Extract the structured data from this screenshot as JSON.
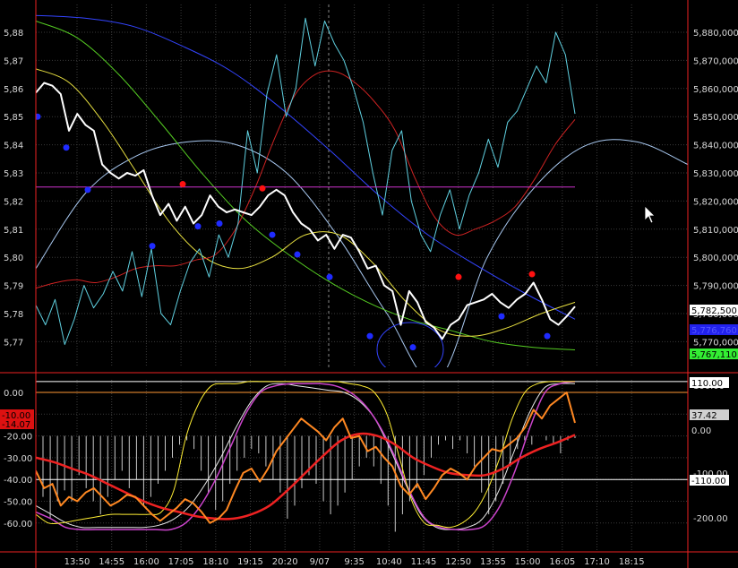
{
  "chart_data": [
    {
      "type": "line",
      "panel": "price",
      "left_ticks": [
        "5,88",
        "5,87",
        "5,86",
        "5,85",
        "5,84",
        "5,83",
        "5,82",
        "5,81",
        "5,80",
        "5,79",
        "5,78",
        "5,77"
      ],
      "right_ticks": [
        "5,880,000",
        "5,870,000",
        "5,860,000",
        "5,850,000",
        "5,840,000",
        "5,830,000",
        "5,820,000",
        "5,810,000",
        "5,800,000",
        "5,790,000",
        "5,780,000",
        "5,770,000"
      ],
      "ylim_right": [
        5765000,
        5889000
      ],
      "price_series": {
        "color": "#ffffff",
        "values": [
          5858500,
          5862000,
          5861000,
          5858000,
          5845000,
          5851000,
          5847000,
          5845000,
          5833000,
          5830000,
          5828000,
          5830000,
          5829000,
          5831000,
          5822000,
          5815000,
          5819000,
          5813000,
          5818000,
          5812000,
          5815000,
          5822000,
          5818000,
          5816000,
          5817000,
          5816000,
          5815000,
          5818000,
          5822000,
          5824000,
          5822000,
          5816000,
          5812000,
          5810000,
          5806000,
          5808000,
          5803000,
          5808000,
          5807000,
          5802000,
          5796000,
          5797000,
          5790000,
          5788000,
          5776000,
          5788000,
          5784000,
          5777000,
          5775000,
          5771000,
          5776000,
          5778000,
          5783000,
          5784000,
          5785000,
          5787000,
          5784000,
          5782000,
          5785000,
          5787000,
          5791000,
          5785000,
          5778000,
          5776000,
          5779000,
          5782500
        ]
      },
      "cyan_series": {
        "color": "#5fd0e0",
        "values": [
          5783000,
          5776000,
          5785000,
          5769000,
          5778000,
          5790000,
          5782000,
          5787000,
          5795000,
          5788000,
          5802000,
          5786000,
          5803000,
          5780000,
          5776000,
          5788000,
          5798000,
          5803000,
          5793000,
          5808000,
          5800000,
          5812000,
          5845000,
          5830000,
          5858000,
          5872000,
          5850000,
          5860000,
          5885000,
          5868000,
          5884000,
          5876000,
          5870000,
          5860000,
          5848000,
          5830000,
          5815000,
          5838000,
          5845000,
          5820000,
          5808000,
          5802000,
          5815000,
          5824000,
          5810000,
          5822000,
          5830000,
          5842000,
          5832000,
          5848000,
          5852000,
          5860000,
          5868000,
          5862000,
          5880000,
          5872000,
          5851000
        ]
      },
      "red_series": {
        "color": "#cc2222",
        "values": [
          5789000,
          5791000,
          5792000,
          5791000,
          5793000,
          5796000,
          5797000,
          5797000,
          5799000,
          5801000,
          5810000,
          5825000,
          5843000,
          5858000,
          5865000,
          5866000,
          5862000,
          5855000,
          5845000,
          5828000,
          5814000,
          5808000,
          5810000,
          5813000,
          5818000,
          5828000,
          5840000,
          5849000
        ]
      },
      "blue_curve": {
        "color": "#3344ff",
        "values": [
          5886000,
          5885000,
          5882000,
          5875000,
          5866000,
          5853000,
          5838000,
          5822000,
          5808000,
          5797000,
          5787000,
          5778000
        ]
      },
      "green_curve": {
        "color": "#55cc22",
        "values": [
          5884000,
          5878000,
          5865000,
          5848000,
          5830000,
          5814000,
          5802000,
          5792000,
          5784000,
          5778000,
          5774000,
          5770000,
          5768000,
          5767110
        ]
      },
      "yellow_curve": {
        "color": "#e8e040",
        "values": [
          5867000,
          5862000,
          5848000,
          5830000,
          5812000,
          5800000,
          5796000,
          5800000,
          5808000,
          5808000,
          5798000,
          5784000,
          5774000,
          5772000,
          5775000,
          5780000,
          5784000
        ]
      },
      "lightblue_curve": {
        "color": "#a8c8f0",
        "values": [
          5796000,
          5823000,
          5836000,
          5841000,
          5840000,
          5830000,
          5808000,
          5780000,
          5756000,
          5800000,
          5826000,
          5840000,
          5841000,
          5833000
        ]
      },
      "horizontal_line": {
        "value": 5825000,
        "color": "#cc33cc"
      },
      "red_dots": [
        5826000,
        5824500,
        5793000,
        5794000
      ],
      "blue_dots": [
        5850000,
        5839000,
        5824000,
        5804000,
        5811000,
        5812000,
        5808000,
        5801000,
        5793000,
        5772000,
        5768000,
        5779000,
        5772000
      ],
      "price_tags": [
        {
          "label": "5,782,500",
          "bg": "#ffffff",
          "fg": "#000000"
        },
        {
          "label": "5,776,760",
          "bg": "#2222ee",
          "fg": "#5555ff"
        },
        {
          "label": "5,767,110",
          "bg": "#33ee33",
          "fg": "#000000"
        }
      ]
    },
    {
      "type": "line",
      "panel": "oscillator",
      "left_ticks": [
        "0.00",
        "-10.00",
        "-20.00",
        "-30.00",
        "-40.00",
        "-50.00",
        "-60.00"
      ],
      "right_ticks": [
        "100.00",
        "0.00",
        "-100.00",
        "-200.00"
      ],
      "ylim_left": [
        -66,
        6
      ],
      "left_tags": [
        {
          "label": "-10.00",
          "bg": "#dd1111",
          "fg": "#000000"
        },
        {
          "label": "-14.07",
          "bg": "#dd1111",
          "fg": "#000000"
        }
      ],
      "right_tags": [
        {
          "label": "110.00",
          "bg": "#ffffff",
          "fg": "#000000"
        },
        {
          "label": "37.42",
          "bg": "#d0d0d0",
          "fg": "#000000"
        },
        {
          "label": "0.00",
          "bg": "#000000",
          "fg": "#d8d8d8"
        },
        {
          "label": "-110.00",
          "bg": "#ffffff",
          "fg": "#000000"
        }
      ],
      "histogram": {
        "color": "#c8c8c8",
        "baseline": -20,
        "values": [
          -42,
          -48,
          -58,
          -50,
          -45,
          -50,
          -38,
          -44,
          -50,
          -56,
          -48,
          -40,
          -36,
          -44,
          -40,
          -52,
          -48,
          -42,
          -36,
          -30,
          -24,
          -22,
          -26,
          -36,
          -46,
          -54,
          -50,
          -42,
          -36,
          -30,
          -26,
          -28,
          -34,
          -40,
          -46,
          -58,
          -52,
          -44,
          -38,
          -42,
          -50,
          -56,
          -52,
          -46,
          -40,
          -34,
          -30,
          -34,
          -42,
          -52,
          -64,
          -56,
          -50,
          -44,
          -38,
          -30,
          -24,
          -22,
          -26,
          -22,
          -28,
          -34,
          -46,
          -56,
          -50,
          -42,
          -34,
          -26,
          -22,
          -24,
          -20,
          -22,
          -24,
          -28,
          -22,
          -21
        ]
      },
      "orange_series": {
        "color": "#ff8822",
        "values": [
          -36,
          -44,
          -42,
          -52,
          -48,
          -50,
          -46,
          -44,
          -48,
          -52,
          -50,
          -47,
          -48,
          -52,
          -56,
          -59,
          -56,
          -53,
          -49,
          -51,
          -55,
          -60,
          -58,
          -54,
          -45,
          -37,
          -35,
          -41,
          -35,
          -27,
          -22,
          -17,
          -12,
          -15,
          -18,
          -22,
          -16,
          -12,
          -21,
          -20,
          -27,
          -25,
          -30,
          -34,
          -43,
          -47,
          -42,
          -49,
          -44,
          -38,
          -35,
          -37,
          -40,
          -34,
          -30,
          -26,
          -27,
          -24,
          -21,
          -16,
          -8,
          -12,
          -6,
          -3,
          0,
          -14
        ]
      },
      "red_series": {
        "color": "#ee2222",
        "values": [
          -30,
          -32,
          -35,
          -38,
          -42,
          -46,
          -50,
          -53,
          -55,
          -57,
          -58,
          -58,
          -56,
          -52,
          -45,
          -37,
          -29,
          -22,
          -19,
          -20,
          -24,
          -30,
          -34,
          -37,
          -38,
          -38,
          -35,
          -30,
          -26,
          -23,
          -19.5
        ]
      },
      "yellow_series": {
        "color": "#ffee33",
        "values": [
          -56,
          -60,
          -60,
          -59,
          -58,
          -57,
          -56,
          -56,
          -56,
          -56,
          -55,
          -45,
          -20,
          -5,
          3,
          4,
          4,
          5,
          5,
          5,
          5,
          5,
          5,
          5,
          5,
          4,
          3,
          0,
          -10,
          -30,
          -50,
          -60,
          -61,
          -62,
          -60,
          -55,
          -45,
          -30,
          -12,
          0,
          4,
          5,
          5,
          5
        ]
      },
      "magenta_series": {
        "color": "#cc44cc",
        "values": [
          -55,
          -58,
          -62,
          -63,
          -63,
          -63,
          -63,
          -63,
          -63,
          -63,
          -60,
          -52,
          -40,
          -25,
          -10,
          0,
          3,
          4,
          4,
          4,
          3,
          0,
          -6,
          -16,
          -30,
          -46,
          -58,
          -62,
          -63,
          -63,
          -61,
          -52,
          -36,
          -16,
          0,
          4,
          5
        ]
      },
      "white_curve": {
        "color": "#e8e8e8",
        "values": [
          -52,
          -56,
          -60,
          -62,
          -62,
          -62,
          -62,
          -62,
          -61,
          -58,
          -52,
          -42,
          -30,
          -16,
          -4,
          3,
          4,
          3,
          2,
          1,
          0,
          -4,
          -12,
          -26,
          -42,
          -56,
          -62,
          -63,
          -62,
          -58,
          -46,
          -28,
          -10,
          2,
          4,
          4
        ]
      },
      "hlines": [
        {
          "value": 5,
          "color": "#ffffff"
        },
        {
          "value": 0,
          "color": "#ff9933"
        },
        {
          "value": -40,
          "color": "#ffffff"
        }
      ]
    }
  ],
  "x_axis": {
    "labels": [
      "13:50",
      "14:55",
      "16:00",
      "17:05",
      "18:10",
      "19:15",
      "20:20",
      "9/07",
      "9:35",
      "10:40",
      "11:45",
      "12:50",
      "13:55",
      "15:00",
      "16:05",
      "17:10",
      "18:15"
    ]
  },
  "cursor": {
    "symbol": "mouse-pointer-icon"
  }
}
